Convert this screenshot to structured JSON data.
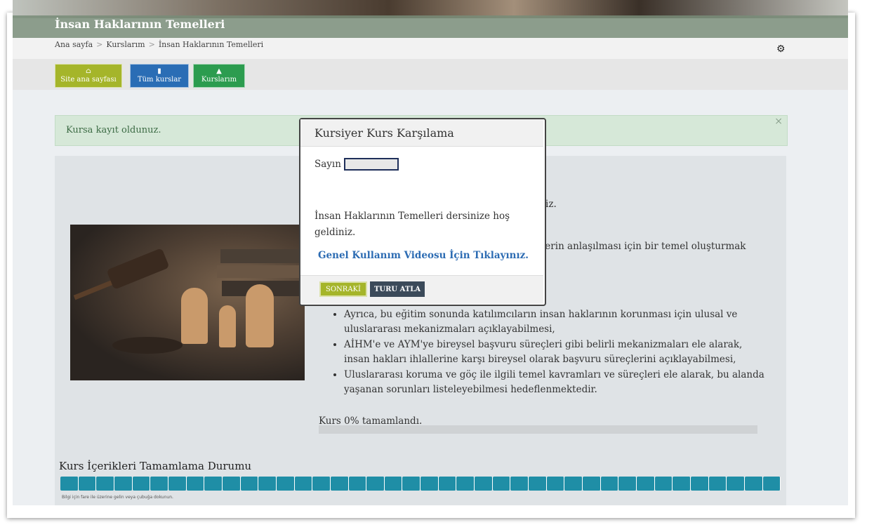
{
  "header": {
    "course_title": "İnsan Haklarının Temelleri",
    "breadcrumb": [
      "Ana sayfa",
      "Kurslarım",
      "İnsan Haklarının Temelleri"
    ],
    "breadcrumb_separator": ">",
    "settings_icon": "gear-icon"
  },
  "nav_buttons": [
    {
      "label": "Site ana sayfası",
      "icon": "home-icon",
      "color": "#a5b52a"
    },
    {
      "label": "Tüm kurslar",
      "icon": "book-icon",
      "color": "#2a6db5"
    },
    {
      "label": "Kurslarım",
      "icon": "graduation-cap-icon",
      "color": "#2c9c4f"
    }
  ],
  "alert": {
    "text": "Kursa kayıt oldunuz.",
    "close_icon": "close-icon"
  },
  "course": {
    "intro_fragment": "iniz.",
    "goal_fragment": "elerin anlaşılması için bir temel oluşturmak",
    "list_items": [
      "Ayrıca, bu eğitim sonunda katılımcıların insan haklarının korunması için ulusal ve uluslararası mekanizmaları açıklayabilmesi,",
      "AİHM'e ve AYM'ye bireysel başvuru süreçleri gibi belirli mekanizmaları ele alarak, insan hakları ihlallerine karşı bireysel olarak başvuru süreçlerini açıklayabilmesi,",
      "Uluslararası koruma ve göç ile ilgili temel kavramları ve süreçleri ele alarak, bu alanda yaşanan sorunları listeleyebilmesi hedeflenmektedir."
    ],
    "progress_text": "Kurs 0% tamamlandı.",
    "progress_value": 0
  },
  "status": {
    "title": "Kurs İçerikleri Tamamlama Durumu",
    "segments": 40,
    "hint": "Bilgi için fare ile üzerine gelin veya çubuğa dokunun."
  },
  "modal": {
    "title": "Kursiyer Kurs Karşılama",
    "greeting": "Sayın",
    "message": "İnsan Haklarının Temelleri dersinize hoş geldiniz.",
    "link_text": "Genel Kullanım Videosu İçin Tıklayınız.",
    "next_label": "SONRAKİ",
    "skip_label": "TURU ATLA"
  },
  "colors": {
    "accent_green": "#a5b52a",
    "link_blue": "#2d6cb3",
    "status_teal": "#1f8ea6"
  }
}
